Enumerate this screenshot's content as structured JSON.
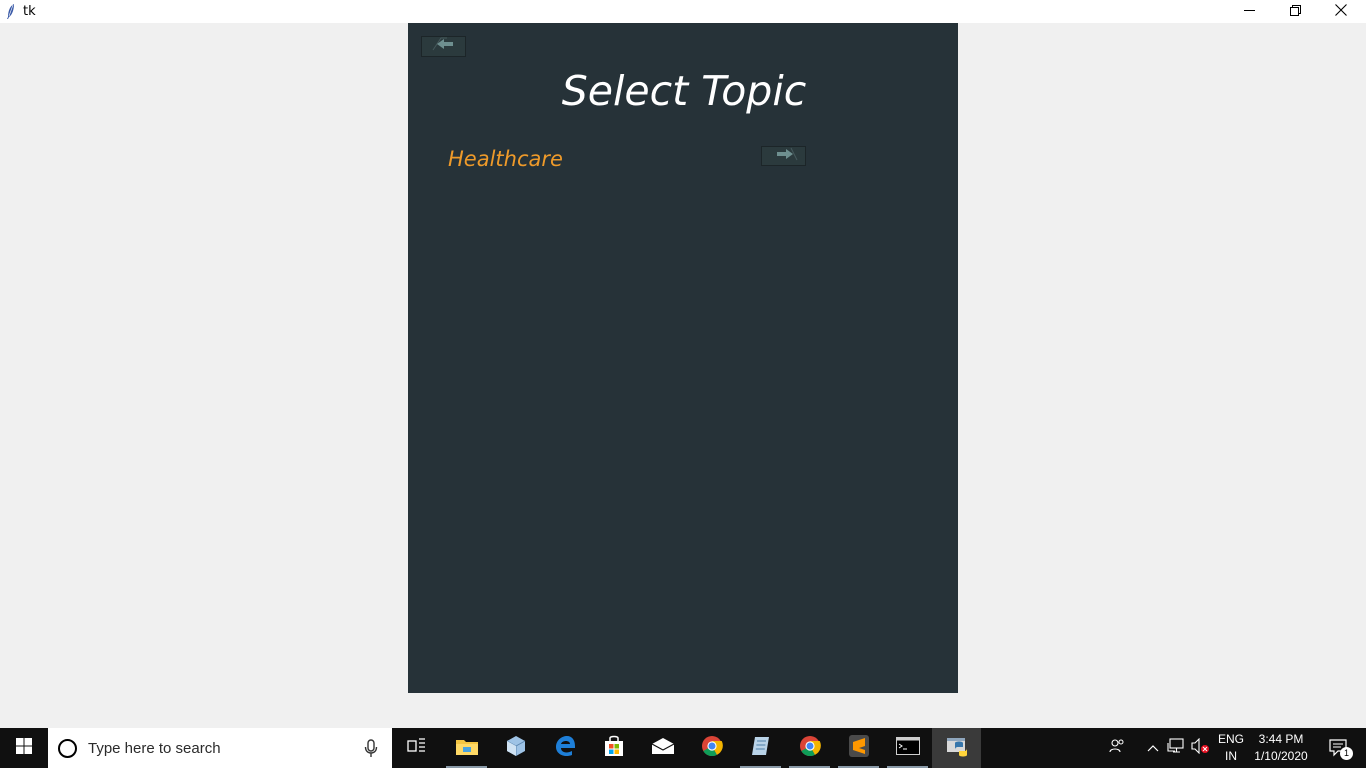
{
  "window": {
    "title": "tk",
    "icons": {
      "app": "tk-feather-icon",
      "minimize": "minimize-icon",
      "maximize": "restore-icon",
      "close": "close-icon"
    }
  },
  "app": {
    "background": "#263238",
    "back_button_icon": "arrow-left-icon",
    "title": "Select Topic",
    "topics": [
      {
        "label": "Healthcare",
        "color": "#ee9a2a",
        "action_icon": "arrow-right-icon"
      }
    ]
  },
  "taskbar": {
    "search_placeholder": "Type here to search",
    "apps": [
      {
        "name": "task-view-icon"
      },
      {
        "name": "file-explorer-icon"
      },
      {
        "name": "3d-box-icon"
      },
      {
        "name": "edge-icon"
      },
      {
        "name": "store-icon"
      },
      {
        "name": "mail-icon"
      },
      {
        "name": "chrome-icon"
      },
      {
        "name": "notes-app-icon"
      },
      {
        "name": "chrome-icon"
      },
      {
        "name": "sublime-text-icon"
      },
      {
        "name": "terminal-icon"
      },
      {
        "name": "python-icon"
      }
    ],
    "tray": {
      "language_line1": "ENG",
      "language_line2": "IN",
      "time": "3:44 PM",
      "date": "1/10/2020",
      "notification_count": "1"
    }
  }
}
